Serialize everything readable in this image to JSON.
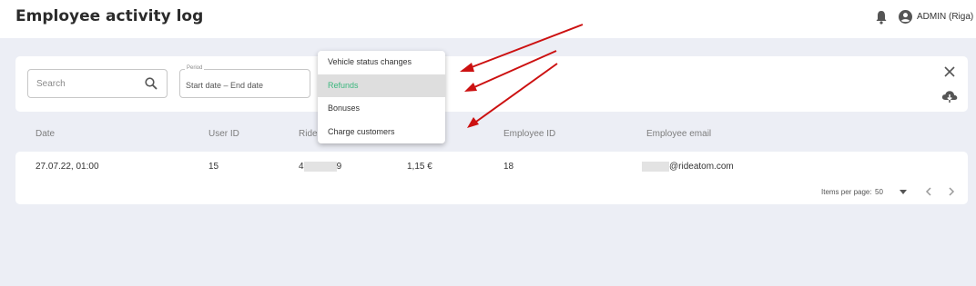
{
  "header": {
    "title": "Employee activity log",
    "user_label": "ADMIN (Riga)"
  },
  "filters": {
    "search_placeholder": "Search",
    "period_label": "Period",
    "period_value": "Start date – End date"
  },
  "dropdown": {
    "items": [
      {
        "label": "Vehicle status changes",
        "active": false
      },
      {
        "label": "Refunds",
        "active": true
      },
      {
        "label": "Bonuses",
        "active": false
      },
      {
        "label": "Charge customers",
        "active": false
      }
    ]
  },
  "table": {
    "columns": [
      "Date",
      "User ID",
      "Ride",
      "Employee ID",
      "Employee email"
    ],
    "rows": [
      {
        "date": "27.07.22, 01:00",
        "user_id": "15",
        "ride_prefix": "4",
        "ride_suffix": "9",
        "amount": "1,15 €",
        "employee_id": "18",
        "email_domain": "@rideatom.com"
      }
    ]
  },
  "pagination": {
    "items_per_page_label": "Items per page:",
    "items_per_page_value": "50"
  },
  "icons": {
    "bell": "bell-icon",
    "user": "account-circle-icon",
    "search": "search-icon",
    "close": "close-icon",
    "download": "cloud-download-icon",
    "dropdown_caret": "caret-down-icon",
    "prev": "chevron-left-icon",
    "next": "chevron-right-icon"
  },
  "colors": {
    "background": "#eceef5",
    "active_text": "#3bb77e",
    "annotation_arrow": "#cc1111"
  }
}
